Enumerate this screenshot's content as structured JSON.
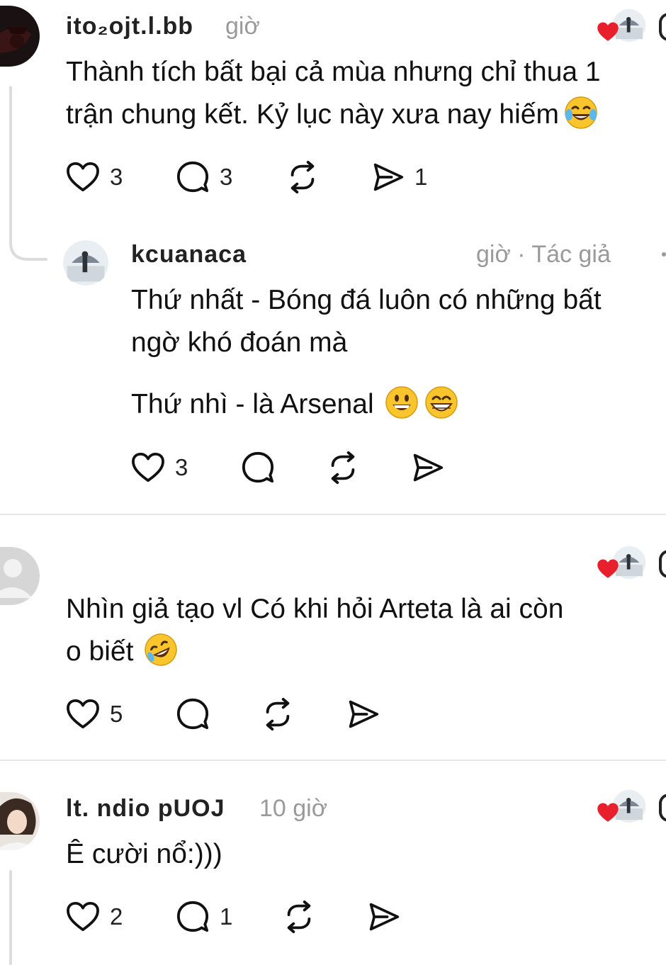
{
  "comments": [
    {
      "username": "ito₂ojt.l.bb",
      "time": "giờ",
      "text_lines": [
        "Thành tích bất bại cả mùa nhưng chỉ thua 1",
        "trận chung kết. Kỷ lục này xưa nay hiếm"
      ],
      "emoji_end": "tears-of-joy",
      "likes": "3",
      "replies": "3",
      "shares": "1",
      "liked_by_creator": true
    },
    {
      "username": "kcuanaca",
      "time": "giờ · Tác giả",
      "text_lines": [
        "Thứ nhất - Bóng đá luôn có những bất",
        "ngờ khó đoán mà"
      ],
      "text_line_3": "Thứ nhì - là Arsenal",
      "emoji_end": "grinning",
      "likes": "3",
      "replies": "",
      "shares": "",
      "liked_by_creator": false
    },
    {
      "username": "",
      "time": "",
      "text_lines": [
        "Nhìn giả tạo vl Có khi hỏi Arteta là ai còn",
        "o biết"
      ],
      "emoji_end": "rofl",
      "likes": "5",
      "replies": "",
      "shares": "",
      "liked_by_creator": true
    },
    {
      "username": "lt. ndio pUOJ",
      "time": "10 giờ",
      "text_lines": [
        "Ê cười nổ:)))"
      ],
      "likes": "2",
      "replies": "1",
      "shares": "",
      "liked_by_creator": true
    }
  ],
  "colors": {
    "heart": "#e8202e",
    "text": "#101010",
    "meta": "#9a9a9a",
    "divider": "#e6e6e6",
    "thread": "#dcdcdc"
  }
}
